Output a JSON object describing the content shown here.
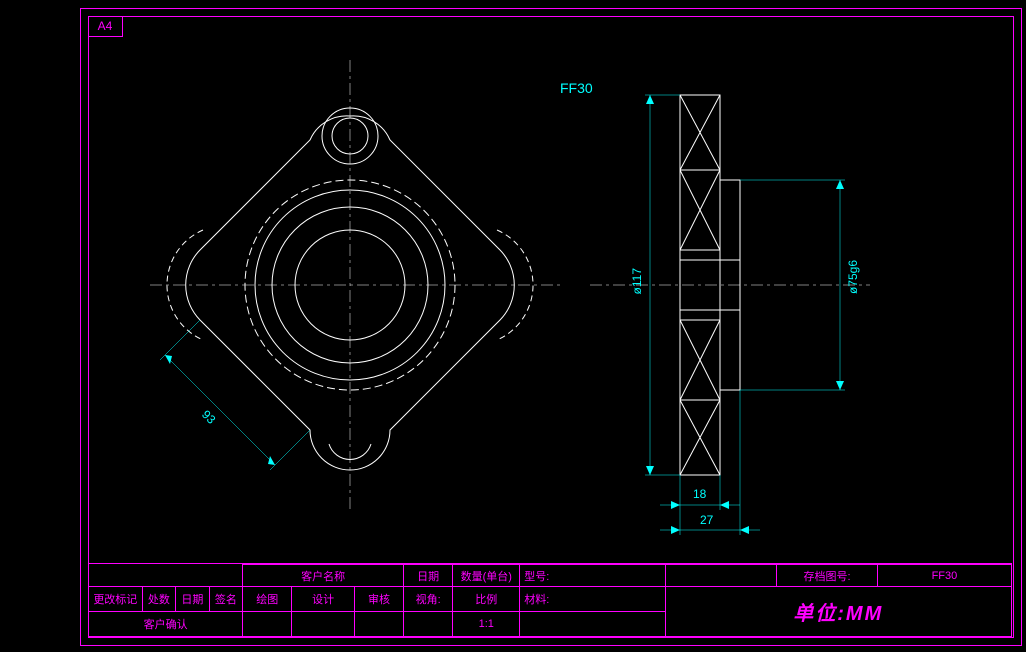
{
  "sheet_size": "A4",
  "part_label": "FF30",
  "dimensions": {
    "diag_length": "93",
    "outer_diameter": "ø117",
    "fit_diameter": "ø75g6",
    "width_small": "18",
    "width_large": "27"
  },
  "title_block": {
    "row1": {
      "customer_name": "客户名称",
      "date": "日期",
      "qty_per_unit": "数量(单台)",
      "model": "型号:",
      "archive_no": "存档图号:",
      "archive_value": "FF30"
    },
    "row2_left": {
      "change_mark": "更改标记",
      "qty": "处数",
      "date": "日期",
      "signature": "签名"
    },
    "row2_right": {
      "drawing": "绘图",
      "design": "设计",
      "review": "审核",
      "angle": "视角:",
      "scale": "比例",
      "scale_value": "1:1",
      "material": "材料:"
    },
    "row3": {
      "customer_confirm": "客户确认"
    },
    "unit_label": "单位:MM"
  }
}
